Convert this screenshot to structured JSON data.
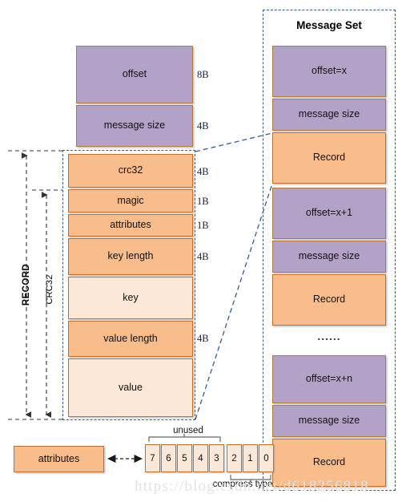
{
  "diagram": {
    "title_message_set": "Message Set",
    "watermark": "https://blog.csdn.net/d618256818"
  },
  "left_column": {
    "header_fields": [
      {
        "label": "offset",
        "size": "8B",
        "color": "purple"
      },
      {
        "label": "message size",
        "size": "4B",
        "color": "purple"
      }
    ],
    "record_fields": [
      {
        "label": "crc32",
        "size": "4B",
        "color": "orange"
      },
      {
        "label": "magic",
        "size": "1B",
        "color": "orange"
      },
      {
        "label": "attributes",
        "size": "1B",
        "color": "orange"
      },
      {
        "label": "key length",
        "size": "4B",
        "color": "orange"
      },
      {
        "label": "key",
        "size": "",
        "color": "pale"
      },
      {
        "label": "value length",
        "size": "4B",
        "color": "orange"
      },
      {
        "label": "value",
        "size": "",
        "color": "pale"
      }
    ],
    "span_labels": {
      "record": "RECORD",
      "crc32": "CRC32"
    }
  },
  "message_set": {
    "title": "Message Set",
    "ellipsis": "......",
    "groups": [
      {
        "offset": "offset=x",
        "message_size": "message size",
        "record": "Record"
      },
      {
        "offset": "offset=x+1",
        "message_size": "message size",
        "record": "Record"
      },
      {
        "offset": "offset=x+n",
        "message_size": "message size",
        "record": "Record"
      }
    ]
  },
  "attributes_detail": {
    "box_label": "attributes",
    "bits": [
      "7",
      "6",
      "5",
      "4",
      "3",
      "2",
      "1",
      "0"
    ],
    "unused_label": "unused",
    "compress_label": "compress type"
  },
  "colors": {
    "purple": "#b3a2c7",
    "orange": "#f8bd8b",
    "pale": "#fce8d8",
    "border_orange": "#c0702a",
    "dashed_blue": "#3b5a8c",
    "arrow_dark": "#333333"
  }
}
